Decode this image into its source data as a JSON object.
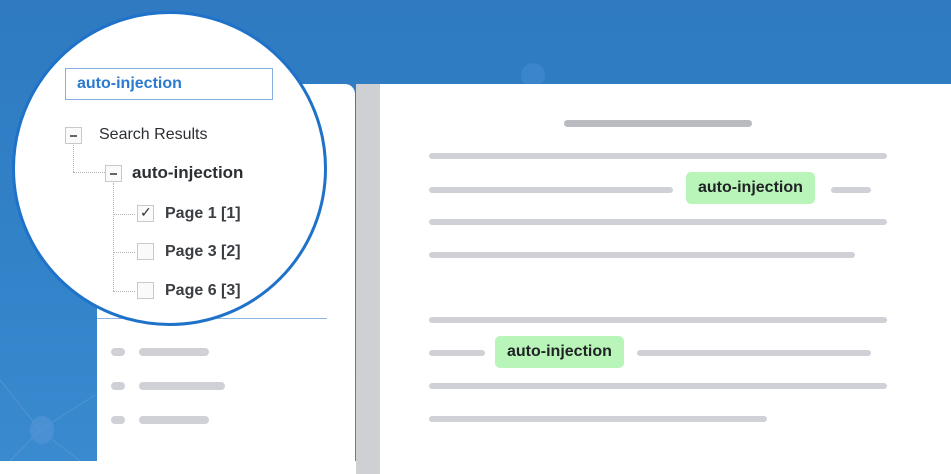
{
  "magnifier": {
    "search_value": "auto-injection",
    "tree": {
      "root_label": "Search Results",
      "term_label": "auto-injection",
      "pages": [
        {
          "label": "Page 1  [1]",
          "checked": true
        },
        {
          "label": "Page 3 [2]",
          "checked": false
        },
        {
          "label": "Page 6 [3]",
          "checked": false
        }
      ]
    }
  },
  "document": {
    "highlights": [
      "auto-injection",
      "auto-injection"
    ]
  },
  "colors": {
    "background": "#2f7ac1",
    "highlight": "#b9f5b8",
    "search_text": "#2a7ad2"
  }
}
